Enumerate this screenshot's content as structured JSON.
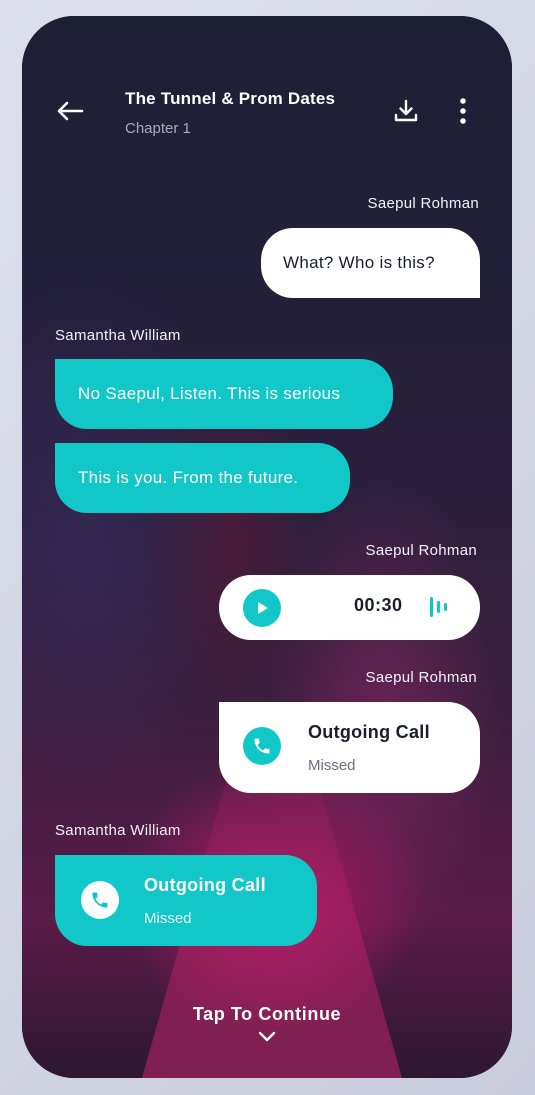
{
  "header": {
    "title": "The Tunnel & Prom Dates",
    "subtitle": "Chapter 1",
    "back_icon": "arrow-left-icon",
    "download_icon": "download-icon",
    "menu_icon": "more-vertical-icon"
  },
  "messages": [
    {
      "sender": "Saepul Rohman",
      "type": "text",
      "text": "What? Who is this?"
    },
    {
      "sender": "Samantha William",
      "type": "text",
      "texts": [
        "No Saepul, Listen. This is serious",
        "This is you. From the future."
      ]
    },
    {
      "sender": "Saepul Rohman",
      "type": "voice",
      "duration": "00:30",
      "play_icon": "play-icon",
      "waveform_icon": "audio-wave-icon"
    },
    {
      "sender": "Saepul Rohman",
      "type": "call",
      "title": "Outgoing Call",
      "status": "Missed",
      "icon": "phone-icon"
    },
    {
      "sender": "Samantha William",
      "type": "call",
      "title": "Outgoing Call",
      "status": "Missed",
      "icon": "phone-icon"
    }
  ],
  "footer": {
    "continue_label": "Tap To Continue",
    "chevron_icon": "chevron-down-icon"
  },
  "colors": {
    "accent": "#12c7c7",
    "bubble_white": "#ffffff",
    "text_dark": "#1b1d2f",
    "background_dark": "#1d1f33"
  }
}
